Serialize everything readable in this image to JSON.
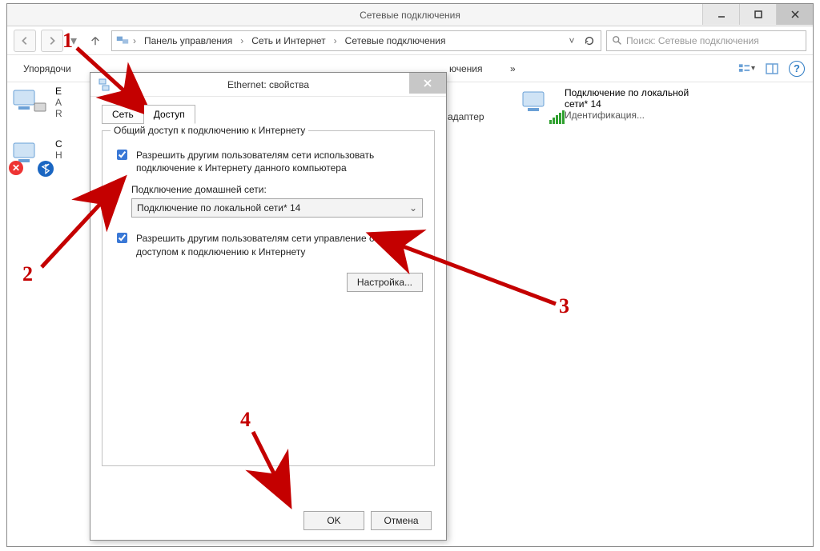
{
  "window": {
    "title": "Сетевые подключения"
  },
  "breadcrumbs": {
    "item1": "Панель управления",
    "item2": "Сеть и Интернет",
    "item3": "Сетевые подключения"
  },
  "search": {
    "placeholder": "Поиск: Сетевые подключения"
  },
  "toolbar": {
    "organize": "Упорядочи",
    "label_behind_left": "ючения",
    "label_behind_chevrons": "»"
  },
  "connections": {
    "left1": {
      "ln1": "E",
      "ln2": "А",
      "ln3": "R"
    },
    "left2": {
      "ln1": "С",
      "ln2": "Н",
      "ln3": ""
    },
    "right": {
      "ln1": "Подключение по локальной",
      "ln2": "сети* 14",
      "ln3": "Идентификация..."
    }
  },
  "dialog": {
    "title": "Ethernet: свойства",
    "tabs": {
      "network": "Сеть",
      "access": "Доступ"
    },
    "group_legend": "Общий доступ к подключению к Интернету",
    "chk1_label": "Разрешить другим пользователям сети использовать подключение к Интернету данного компьютера",
    "home_net_label": "Подключение домашней сети:",
    "combo_value": "Подключение по локальной сети* 14",
    "chk2_label": "Разрешить другим пользователям сети управление общим доступом к подключению к Интернету",
    "settings_btn": "Настройка...",
    "ok": "OK",
    "cancel": "Отмена"
  },
  "annotations": {
    "n1": "1",
    "n2": "2",
    "n3": "3",
    "n4": "4"
  }
}
